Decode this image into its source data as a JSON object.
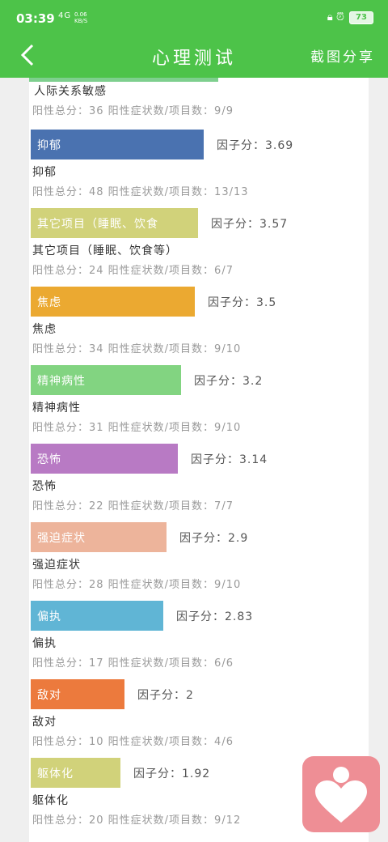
{
  "status": {
    "time": "03:39",
    "signal": "4G",
    "net_speed_value": "0.06",
    "net_speed_unit": "KB/S",
    "battery": "73"
  },
  "header": {
    "title": "心理测试",
    "share_label": "截图分享"
  },
  "top_partial": {
    "name": "人际关系敏感",
    "stats": "阳性总分：36    阳性症状数/项目数：9/9"
  },
  "factors": [
    {
      "bar_label": "抑郁",
      "score_text": "因子分：3.69",
      "name": "抑郁",
      "stats": "阳性总分：48    阳性症状数/项目数：13/13",
      "score": 3.69,
      "color": "#4a72b0"
    },
    {
      "bar_label": "其它项目（睡眠、饮食",
      "score_text": "因子分：3.57",
      "name": "其它项目（睡眠、饮食等）",
      "stats": "阳性总分：24    阳性症状数/项目数：6/7",
      "score": 3.57,
      "color": "#d1d27a"
    },
    {
      "bar_label": "焦虑",
      "score_text": "因子分：3.5",
      "name": "焦虑",
      "stats": "阳性总分：34    阳性症状数/项目数：9/10",
      "score": 3.5,
      "color": "#eba931"
    },
    {
      "bar_label": "精神病性",
      "score_text": "因子分：3.2",
      "name": "精神病性",
      "stats": "阳性总分：31    阳性症状数/项目数：9/10",
      "score": 3.2,
      "color": "#82d481"
    },
    {
      "bar_label": "恐怖",
      "score_text": "因子分：3.14",
      "name": "恐怖",
      "stats": "阳性总分：22    阳性症状数/项目数：7/7",
      "score": 3.14,
      "color": "#b87ac4"
    },
    {
      "bar_label": "强迫症状",
      "score_text": "因子分：2.9",
      "name": "强迫症状",
      "stats": "阳性总分：28    阳性症状数/项目数：9/10",
      "score": 2.9,
      "color": "#edb49b"
    },
    {
      "bar_label": "偏执",
      "score_text": "因子分：2.83",
      "name": "偏执",
      "stats": "阳性总分：17    阳性症状数/项目数：6/6",
      "score": 2.83,
      "color": "#60b5d5"
    },
    {
      "bar_label": "敌对",
      "score_text": "因子分：2",
      "name": "敌对",
      "stats": "阳性总分：10    阳性症状数/项目数：4/6",
      "score": 2,
      "color": "#ec7a3d"
    },
    {
      "bar_label": "躯体化",
      "score_text": "因子分：1.92",
      "name": "躯体化",
      "stats": "阳性总分：20    阳性症状数/项目数：9/12",
      "score": 1.92,
      "color": "#d1d27a"
    }
  ],
  "fab": {
    "icon": "heart-person-icon",
    "color": "#ee8e95"
  }
}
